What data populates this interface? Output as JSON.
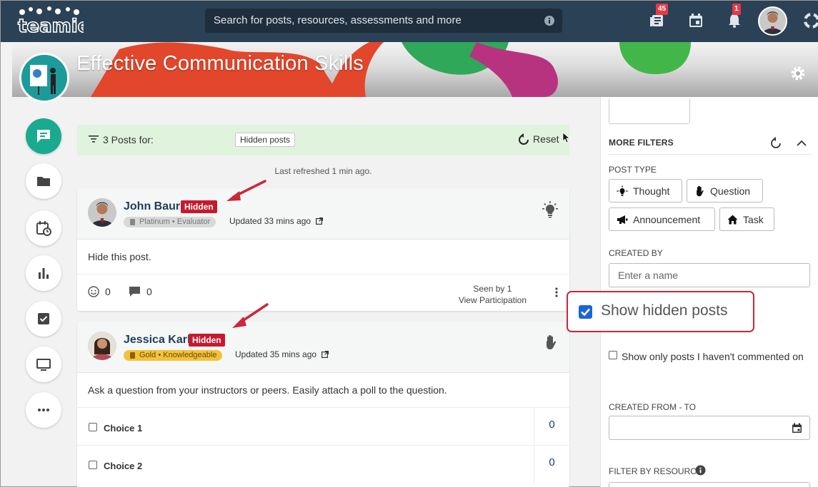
{
  "nav": {
    "logo_text": "teamie",
    "search_placeholder": "Search for posts, resources, assessments and more",
    "newsfeed_badge": "45",
    "notifications_badge": "1"
  },
  "course": {
    "title": "Effective Communication Skills"
  },
  "feed": {
    "filter_summary": "3 Posts for:",
    "filter_chip": "Hidden posts",
    "reset_label": "Reset",
    "refreshed": "Last refreshed 1 min ago.",
    "posts": [
      {
        "author": "John Baur",
        "hidden_label": "Hidden",
        "level": "Platinum",
        "role": "Evaluator",
        "updated": "Updated 33 mins ago",
        "type_icon": "lightbulb-icon",
        "body": "Hide this post.",
        "reactions": "0",
        "comments": "0",
        "seen_by": "Seen by 1",
        "view_participation": "View Participation"
      },
      {
        "author": "Jessica Karl",
        "hidden_label": "Hidden",
        "level": "Gold",
        "role": "Knowledgeable",
        "updated": "Updated 35 mins ago",
        "type_icon": "raised-hand-icon",
        "body": "Ask a question from your instructors or peers. Easily attach a poll to the question.",
        "choices": [
          {
            "label": "Choice 1",
            "votes": "0"
          },
          {
            "label": "Choice 2",
            "votes": "0"
          }
        ]
      }
    ]
  },
  "filters": {
    "more_filters": "MORE FILTERS",
    "post_type_label": "POST TYPE",
    "post_types": [
      "Thought",
      "Question",
      "Announcement",
      "Task"
    ],
    "created_by_label": "CREATED BY",
    "created_by_placeholder": "Enter a name",
    "show_hidden_label": "Show hidden posts",
    "show_hidden_checked": true,
    "uncommented_label": "Show only posts I haven't commented on",
    "created_range_label": "CREATED FROM - TO",
    "filter_resource_label": "FILTER BY RESOURCE"
  },
  "colors": {
    "nav_bg": "#2b4155",
    "accent_green": "#1aaa8f",
    "hidden_red": "#c7192e",
    "annotation_red": "#c8283a",
    "checkbox_blue": "#1d64d6"
  }
}
